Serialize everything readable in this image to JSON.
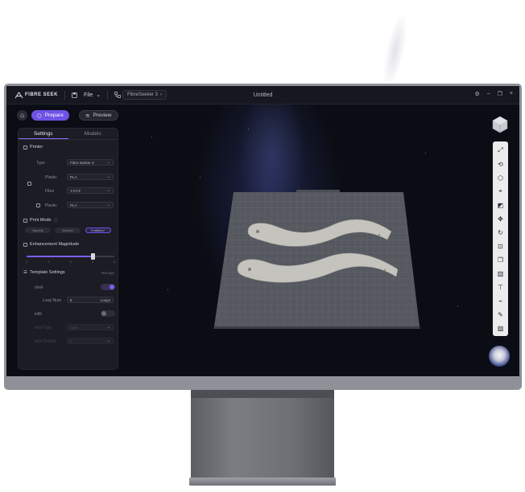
{
  "titlebar": {
    "brand": "FIBRE SEEK",
    "file_menu": "File",
    "printer_name": "FibreSeeker 3",
    "document_title": "Untitled"
  },
  "modes": {
    "prepare": "Prepare",
    "preview": "Preview"
  },
  "panel": {
    "tabs": [
      "Settings",
      "Models"
    ],
    "printer_section": "Printer",
    "type_label": "Type",
    "type_value": "Fibre Seeker 3",
    "plastic_label": "Plastic",
    "plastic_value": "PLA",
    "fiber_label": "Fiber",
    "fiber_value": "Y-CCF",
    "plastic2_label": "Plastic",
    "plastic2_value": "PLA",
    "print_mode_section": "Print Mode",
    "print_modes": [
      "Speedy",
      "Normal",
      "Fortified"
    ],
    "print_mode_selected": "Fortified",
    "enhancement_section": "Enhancement Magnitude",
    "enhancement_level": 0.75,
    "enhancement_ticks": [
      "1",
      "2",
      "3",
      "4",
      "5"
    ],
    "template_section": "Template Settings",
    "template_action": "Manage",
    "toggle1_label": "shell",
    "toggle1_on": true,
    "loop_label": "Loop Num",
    "loop_value": "8",
    "loop_unit": "Loops",
    "toggle2_label": "infill",
    "toggle2_on": false,
    "infill_type_label": "Infill Type",
    "infill_type_value": "Auto",
    "infill_density_label": "Infill Density",
    "infill_density_value": "0"
  },
  "toolbar": {
    "icons": [
      "auto-arrange-icon",
      "auto-orient-icon",
      "add-shape-icon",
      "split-icon",
      "lay-flat-icon",
      "move-icon",
      "rotate-icon",
      "scale-icon",
      "cut-icon",
      "support-icon",
      "measure-icon",
      "paint-icon",
      "seam-icon",
      "assembly-icon"
    ]
  },
  "colors": {
    "accent": "#6f52e6",
    "panel_bg": "#1b1c24",
    "viewport_bg": "#0b0d15",
    "plate": "#5a5c63",
    "part": "#c4c3bd"
  }
}
